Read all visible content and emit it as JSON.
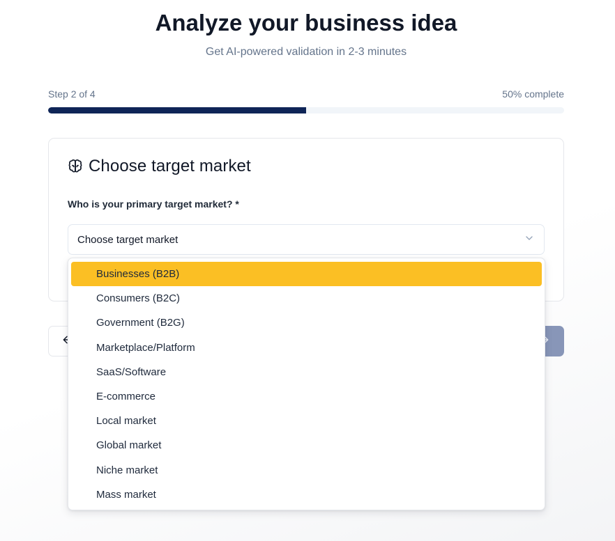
{
  "header": {
    "title": "Analyze your business idea",
    "subtitle": "Get AI-powered validation in 2-3 minutes"
  },
  "progress": {
    "step_label": "Step 2 of 4",
    "percent_label": "50% complete",
    "percent": 50,
    "fill_color": "#0f2557"
  },
  "card": {
    "icon": "brain-icon",
    "title": "Choose target market",
    "field_label": "Who is your primary target market? *"
  },
  "select": {
    "value": "Choose target market",
    "icon": "chevron-down-icon"
  },
  "dropdown": {
    "highlight_color": "#fbbf24",
    "highlighted_index": 0,
    "options": [
      "Businesses (B2B)",
      "Consumers (B2C)",
      "Government (B2G)",
      "Marketplace/Platform",
      "SaaS/Software",
      "E-commerce",
      "Local market",
      "Global market",
      "Niche market",
      "Mass market"
    ]
  },
  "nav": {
    "back_icon": "arrow-left-icon",
    "next_icon": "arrow-right-icon",
    "next_color": "#8896b8"
  }
}
